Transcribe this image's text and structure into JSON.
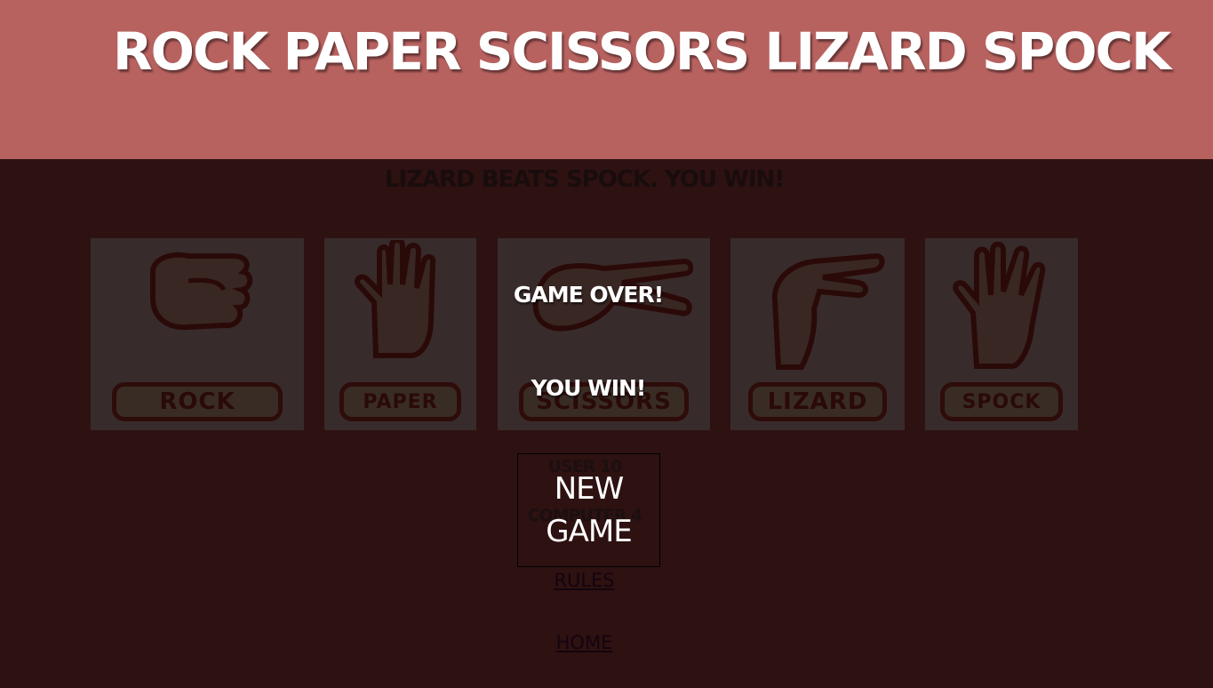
{
  "header": {
    "title": "ROCK PAPER SCISSORS LIZARD SPOCK"
  },
  "result": {
    "text": "LIZARD BEATS SPOCK. YOU WIN!"
  },
  "choices": [
    {
      "label": "ROCK",
      "icon": "rock-hand-icon"
    },
    {
      "label": "PAPER",
      "icon": "paper-hand-icon"
    },
    {
      "label": "SCISSORS",
      "icon": "scissors-hand-icon"
    },
    {
      "label": "LIZARD",
      "icon": "lizard-hand-icon"
    },
    {
      "label": "SPOCK",
      "icon": "spock-hand-icon"
    }
  ],
  "score": {
    "user": "USER 10",
    "computer": "COMPUTER 4"
  },
  "links": {
    "rules": "RULES",
    "home": "HOME"
  },
  "modal": {
    "game_over": "GAME OVER!",
    "you_win": "YOU WIN!",
    "new_game": "NEW GAME"
  },
  "colors": {
    "header_bg": "#b86260",
    "hand_fill": "#f3d8c8",
    "hand_stroke": "#9e3a2e",
    "plate_fill": "#f5f0ce",
    "overlay": "#1a0000"
  }
}
